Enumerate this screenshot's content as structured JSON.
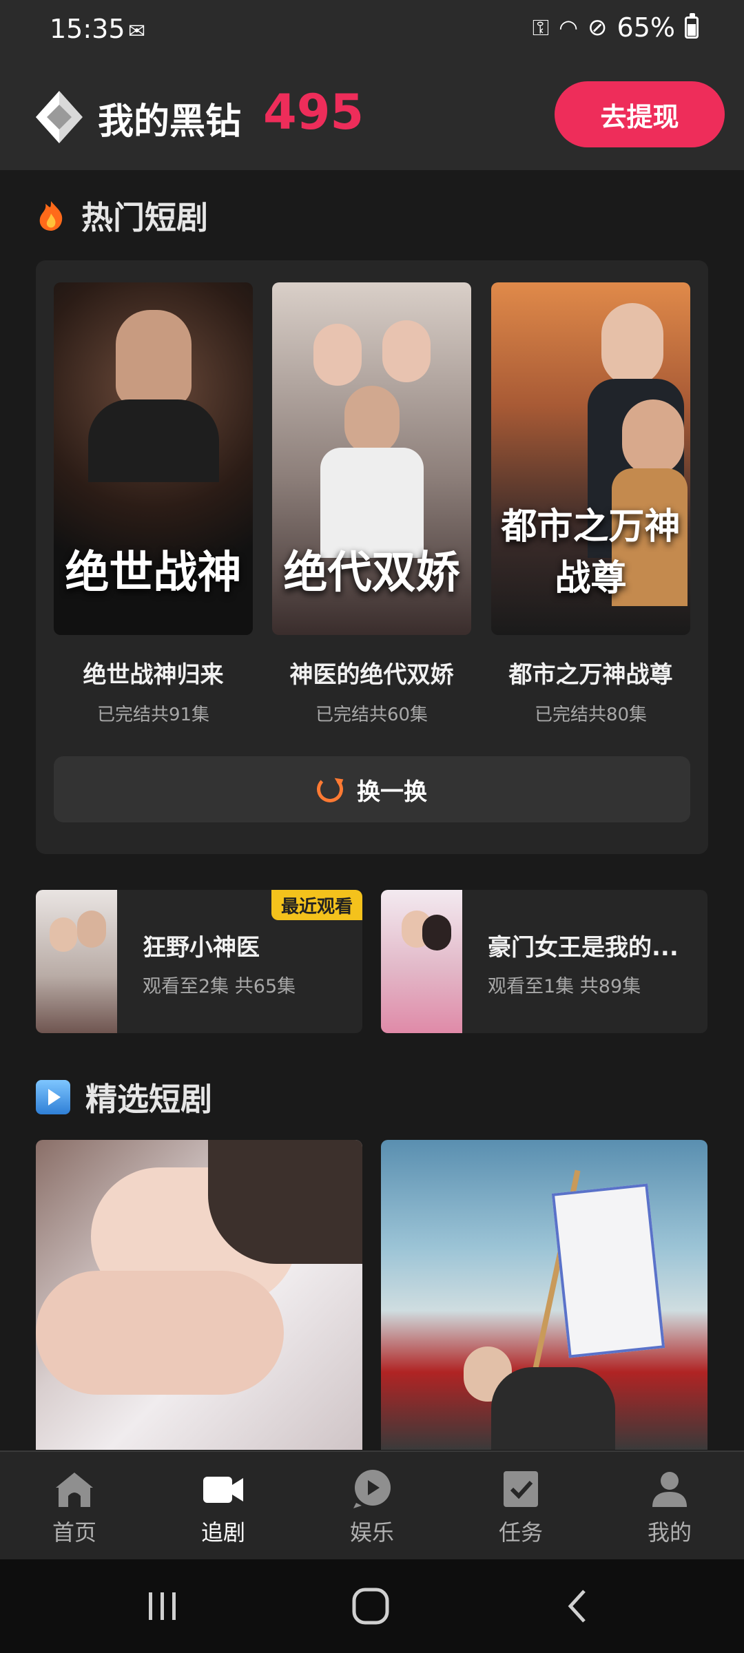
{
  "status_bar": {
    "time": "15:35",
    "battery": "65%",
    "battery_level": 0.65
  },
  "header": {
    "label": "我的黑钻",
    "value": "495",
    "withdraw_button": "去提现"
  },
  "hot_section": {
    "title": "热门短剧",
    "items": [
      {
        "poster_text": "绝世战神",
        "name": "绝世战神归来",
        "sub": "已完结共91集"
      },
      {
        "poster_text": "绝代双娇",
        "name": "神医的绝代双娇",
        "sub": "已完结共60集"
      },
      {
        "poster_text": "都市之万神战尊",
        "name": "都市之万神战尊",
        "sub": "已完结共80集"
      }
    ],
    "refresh_label": "换一换"
  },
  "recent": [
    {
      "name": "狂野小神医",
      "sub": "观看至2集 共65集",
      "badge": "最近观看"
    },
    {
      "name": "豪门女王是我的...",
      "sub": "观看至1集 共89集"
    }
  ],
  "featured_section": {
    "title": "精选短剧"
  },
  "bottom_nav": [
    {
      "label": "首页",
      "icon": "home-icon",
      "active": false
    },
    {
      "label": "追剧",
      "icon": "video-camera-icon",
      "active": true
    },
    {
      "label": "娱乐",
      "icon": "play-bubble-icon",
      "active": false
    },
    {
      "label": "任务",
      "icon": "checkbox-icon",
      "active": false
    },
    {
      "label": "我的",
      "icon": "person-icon",
      "active": false
    }
  ],
  "colors": {
    "accent": "#ee2d5a",
    "background": "#1a1a1a",
    "badge": "#f4c21c"
  }
}
